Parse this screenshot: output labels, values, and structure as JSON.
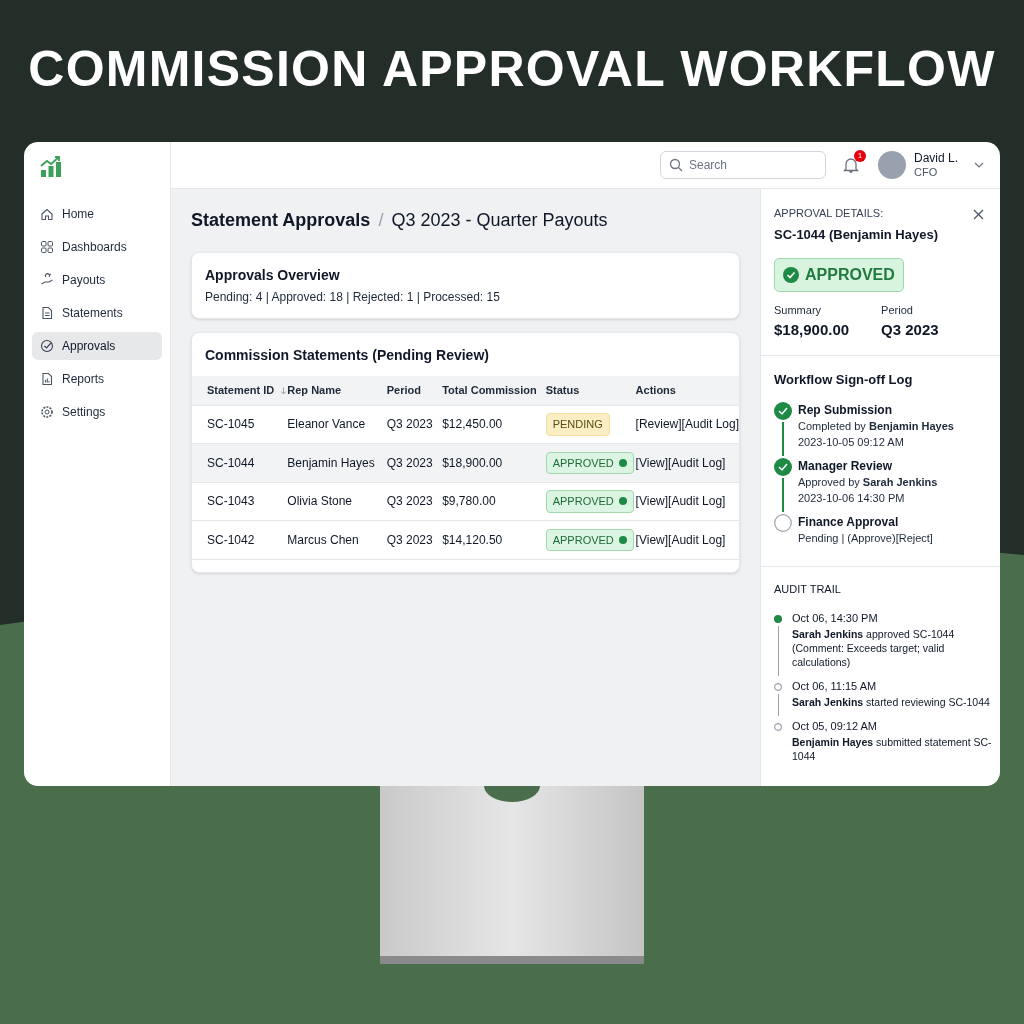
{
  "headline": "COMMISSION APPROVAL WORKFLOW",
  "sidebar": {
    "items": [
      {
        "label": "Home",
        "selected": false
      },
      {
        "label": "Dashboards",
        "selected": false
      },
      {
        "label": "Payouts",
        "selected": false
      },
      {
        "label": "Statements",
        "selected": false
      },
      {
        "label": "Approvals",
        "selected": true
      },
      {
        "label": "Reports",
        "selected": false
      },
      {
        "label": "Settings",
        "selected": false
      }
    ]
  },
  "topbar": {
    "search": {
      "placeholder": "Search"
    },
    "notifications": "1",
    "user": {
      "name": "David L.",
      "role": "CFO"
    }
  },
  "breadcrumb": [
    "Statement Approvals",
    "/",
    "Q3 2023 - Quarter Payouts"
  ],
  "overview": {
    "title": "Approvals Overview",
    "stats": "Pending: 4 | Approved: 18 | Rejected: 1 | Processed: 15"
  },
  "table": {
    "title": "Commission Statements (Pending Review)",
    "columns": [
      "Statement ID",
      "Rep Name",
      "Period",
      "Total Commission",
      "Status",
      "Actions"
    ],
    "rows": [
      {
        "selected": false,
        "cells": [
          "SC-1045",
          "Eleanor Vance",
          "Q3 2023",
          "$12,450.00"
        ],
        "status": {
          "kind": "pending",
          "label": "PENDING"
        },
        "actions": "[Review][Audit Log]"
      },
      {
        "selected": true,
        "cells": [
          "SC-1044",
          "Benjamin Hayes",
          "Q3 2023",
          "$18,900.00"
        ],
        "status": {
          "kind": "approved",
          "label": "APPROVED"
        },
        "actions": "[View][Audit Log]"
      },
      {
        "selected": false,
        "cells": [
          "SC-1043",
          "Olivia Stone",
          "Q3 2023",
          "$9,780.00"
        ],
        "status": {
          "kind": "approved",
          "label": "APPROVED"
        },
        "actions": "[View][Audit Log]"
      },
      {
        "selected": false,
        "cells": [
          "SC-1042",
          "Marcus Chen",
          "Q3 2023",
          "$14,120.50"
        ],
        "status": {
          "kind": "approved",
          "label": "APPROVED"
        },
        "actions": "[View][Audit Log]"
      }
    ]
  },
  "details": {
    "label": "APPROVAL DETAILS:",
    "subject": "SC-1044 (Benjamin Hayes)",
    "status": "APPROVED",
    "summary": {
      "label": "Summary",
      "value": "$18,900.00"
    },
    "period": {
      "label": "Period",
      "value": "Q3 2023"
    }
  },
  "signoff": {
    "title": "Workflow Sign-off Log",
    "steps": [
      {
        "title": "Rep Submission",
        "done": true,
        "lines": [
          "Completed by **Benjamin Hayes**",
          "2023-10-05 09:12 AM"
        ]
      },
      {
        "title": "Manager Review",
        "done": true,
        "lines": [
          "Approved by **Sarah Jenkins**",
          "2023-10-06 14:30 PM"
        ]
      },
      {
        "title": "Finance Approval",
        "done": false,
        "lines": [
          "Pending | (Approve)[Reject]"
        ]
      }
    ]
  },
  "audit": {
    "title": "AUDIT TRAIL",
    "entries": [
      {
        "time": "Oct 06, 14:30 PM",
        "active": true,
        "text": "**Sarah Jenkins** approved SC-1044 (Comment: Exceeds target; valid calculations)"
      },
      {
        "time": "Oct 06, 11:15 AM",
        "active": false,
        "text": "**Sarah Jenkins** started reviewing SC-1044"
      },
      {
        "time": "Oct 05, 09:12 AM",
        "active": false,
        "text": "**Benjamin Hayes** submitted statement SC-1044"
      }
    ]
  }
}
